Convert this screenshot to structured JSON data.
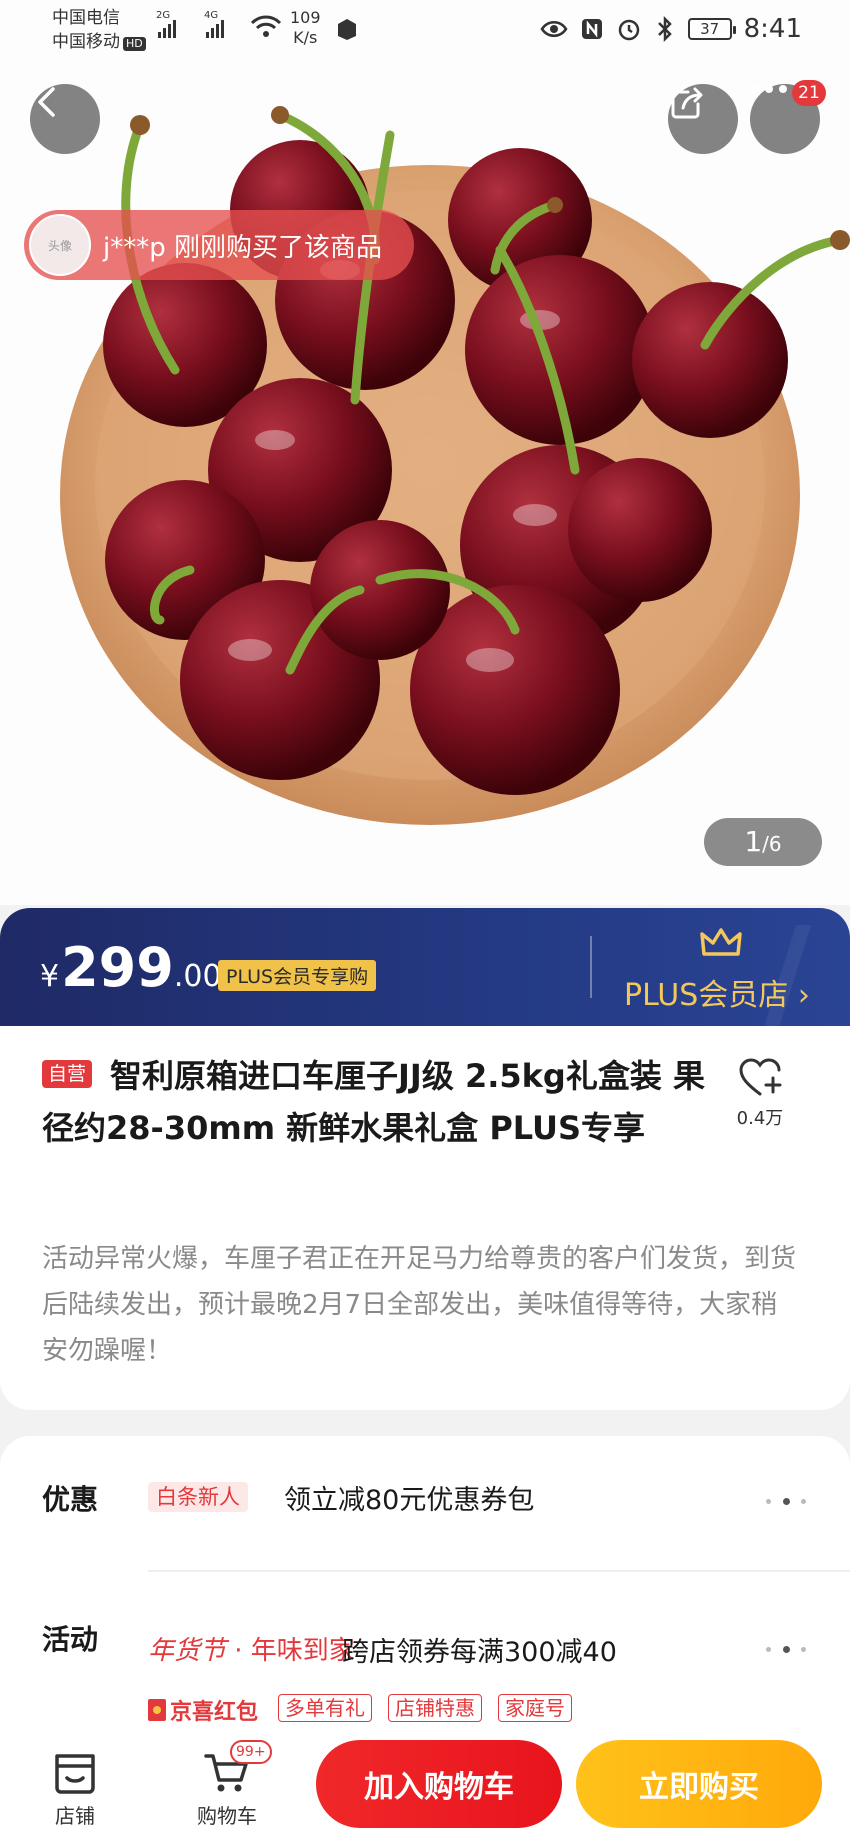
{
  "status_bar": {
    "carrier_1": "中国电信",
    "carrier_2": "中国移动",
    "hd": "HD",
    "net_1": "2G",
    "net_2": "4G",
    "speed_value": "109",
    "speed_unit": "K/s",
    "battery": "37",
    "time": "8:41"
  },
  "top_actions": {
    "more_badge": "21"
  },
  "buyer_toast": {
    "avatar_text": "头像",
    "text": "j***p 刚刚购买了该商品"
  },
  "gallery": {
    "current": "1",
    "total": "/6"
  },
  "price": {
    "currency": "¥",
    "integer": "299",
    "decimal": ".00",
    "plus_tag": "PLUS会员专享购",
    "plus_store": "PLUS会员店 ›"
  },
  "product": {
    "self_tag": "自营",
    "title": "智利原箱进口车厘子JJ级 2.5kg礼盒装 果径约28-30mm 新鲜水果礼盒 PLUS专享",
    "fav_count": "0.4万",
    "description": "活动异常火爆，车厘子君正在开足马力给尊贵的客户们发货，到货后陆续发出，预计最晚2月7日全部发出，美味值得等待，大家稍安勿躁喔！"
  },
  "promotions": {
    "discount_label": "优惠",
    "discount_pill": "白条新人",
    "discount_text": "领立减80元优惠券包",
    "activity_label": "活动",
    "festival_script": "年货节",
    "festival_text": "· 年味到家",
    "activity_text": "跨店领券每满300减40",
    "jx_label": "京喜红包",
    "tags": [
      "多单有礼",
      "店铺特惠",
      "家庭号"
    ]
  },
  "bottom_bar": {
    "store_label": "店铺",
    "cart_label": "购物车",
    "cart_count": "99+",
    "add_cart": "加入购物车",
    "buy_now": "立即购买"
  },
  "colors": {
    "jd_red": "#e4393c",
    "plus_navy": "#243a84",
    "plus_gold": "#f3c75a",
    "buy_orange": "#ffb012"
  }
}
